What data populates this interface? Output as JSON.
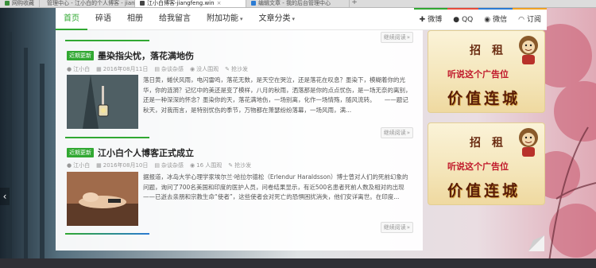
{
  "browser": {
    "tabs": [
      {
        "label": "网购收藏",
        "active": false
      },
      {
        "label": "管理中心 - 江小白的个人博客 - jiangfeng...",
        "active": false
      },
      {
        "label": "江小白博客-jiangfeng.win",
        "active": true
      },
      {
        "label": "编辑文章 - 我的后台管理中心",
        "active": false
      }
    ],
    "new_tab": "+"
  },
  "nav": {
    "items": [
      {
        "label": "首页",
        "active": true,
        "has_caret": false
      },
      {
        "label": "碎语",
        "active": false,
        "has_caret": false
      },
      {
        "label": "相册",
        "active": false,
        "has_caret": false
      },
      {
        "label": "给我留言",
        "active": false,
        "has_caret": false
      },
      {
        "label": "附加功能",
        "active": false,
        "has_caret": true
      },
      {
        "label": "文章分类",
        "active": false,
        "has_caret": true
      }
    ],
    "caret": "▾",
    "social": [
      {
        "icon": "✚",
        "label": "微博",
        "key": "weixin"
      },
      {
        "icon": "●",
        "label": "QQ",
        "key": "qq"
      },
      {
        "icon": "◉",
        "label": "微信",
        "key": "weibo"
      },
      {
        "icon": "◠",
        "label": "订阅",
        "key": "rss"
      }
    ]
  },
  "posts": [
    {
      "badge": "近期更新",
      "title": "墨染指尖忧，落花满地伤",
      "meta": {
        "author": "江小白",
        "date": "2016年08月11日",
        "category": "杂谈杂感",
        "views": "没人围观",
        "comments": "抢沙发"
      },
      "excerpt": "落日黄，蜷伏风雨，电闪雷鸣，落花无数，是天空在哭泣，还是落花在叹息？墨染下，模糊着你的光华，你的涟漪？记忆中的美还是变了模样，八月的秋雨，洒落那是你的点点忧伤，是一场无奈的离别，还是一种深深的怀念？墨染你的天，落花满地伤，一场别离，化作一场情殇，随风流转。　　——题记　　秋天，对我而言，是特别忧伤的季节，万物都在萧瑟纷纷落幕，一场风雨，满...",
      "readmore": "继续阅读"
    },
    {
      "badge": "近期更新",
      "title": "江小白个人博客正式成立",
      "meta": {
        "author": "江小白",
        "date": "2016年08月10日",
        "category": "杂谈杂感",
        "views": "16 人围观",
        "comments": "抢沙发"
      },
      "excerpt": "据报道，冰岛大学心理学家埃尔兰·哈拉尔德松（Erlendur Haraldsson）博士曾对人们的死前幻象的问题，询问了700名美国和印度的医护人员，问卷结果显示，有近500名患者死前人数及相对的出现——已逝去亲朋和宗教生命“使者”，这些使者会对死亡的恐惧困扰消失，他们安详离世。在印度...",
      "readmore": "继续阅读"
    }
  ],
  "top_readmore": "继续阅读",
  "ads": [
    {
      "heading": "招租",
      "tagline": "听说这个广告位",
      "slogan": "价值连城"
    },
    {
      "heading": "招租",
      "tagline": "听说这个广告位",
      "slogan": "价值连城"
    }
  ],
  "icons": {
    "left_arrow": "‹"
  },
  "colors": {
    "accent": "#31a832",
    "ad_red": "#c0182a"
  }
}
